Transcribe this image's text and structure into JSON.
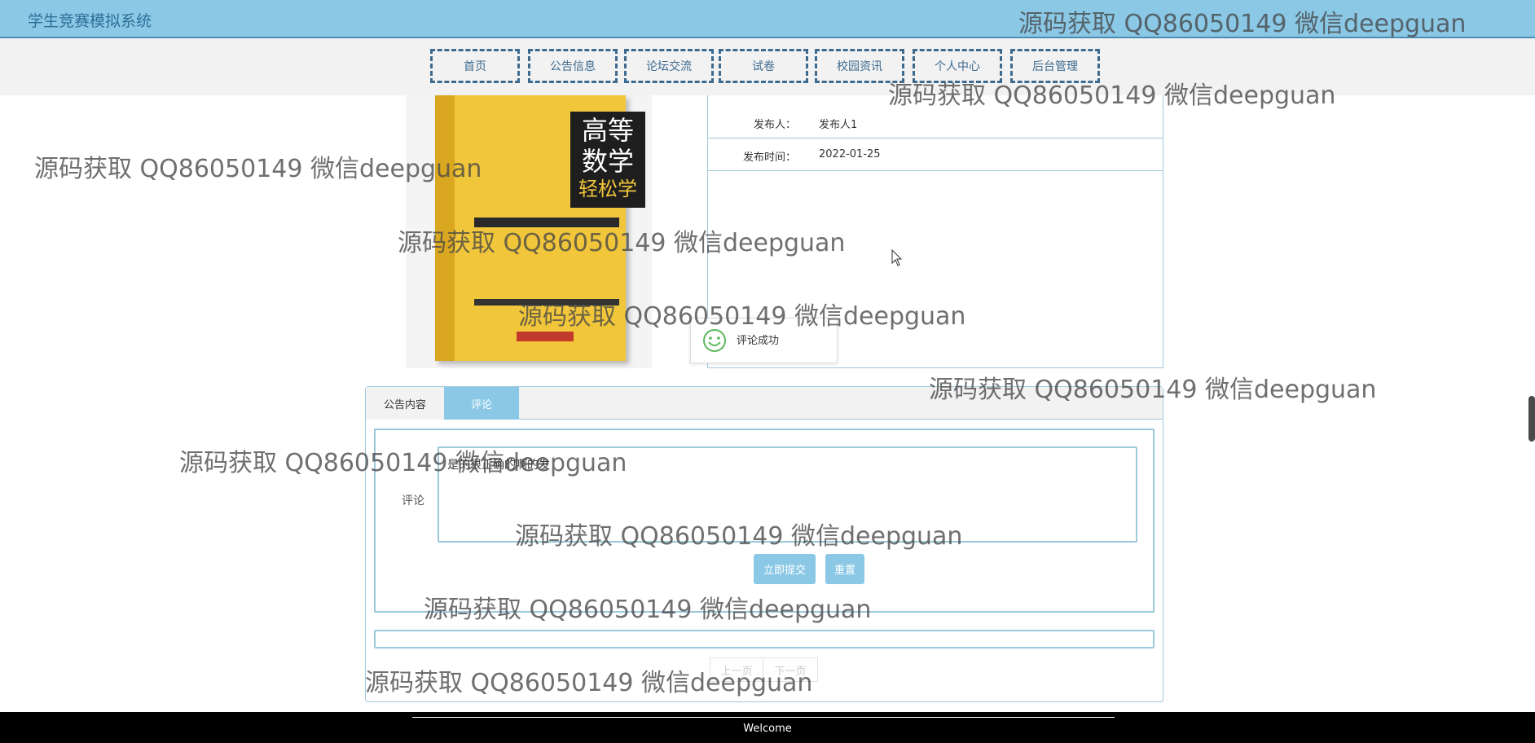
{
  "header": {
    "title": "学生竞赛模拟系统"
  },
  "nav": [
    {
      "label": "首页"
    },
    {
      "label": "公告信息"
    },
    {
      "label": "论坛交流"
    },
    {
      "label": "试卷"
    },
    {
      "label": "校园资讯"
    },
    {
      "label": "个人中心"
    },
    {
      "label": "后台管理"
    }
  ],
  "book": {
    "cover_title_1": "高等",
    "cover_title_2": "数学",
    "cover_subtitle": "轻松学"
  },
  "info": {
    "publisher_label": "发布人：",
    "publisher_value": "发布人1",
    "time_label": "发布时间：",
    "time_value": "2022-01-25"
  },
  "toast": {
    "message": "评论成功"
  },
  "tabs": [
    {
      "label": "公告内容"
    },
    {
      "label": "评论"
    }
  ],
  "comment_form": {
    "label": "评论",
    "value": "是的很正确的啊的发",
    "submit_label": "立即提交",
    "reset_label": "重置"
  },
  "pager": {
    "prev_label": "上一页",
    "next_label": "下一页"
  },
  "footer": {
    "text": "Welcome"
  },
  "watermark": "源码获取 QQ86050149 微信deepguan",
  "colors": {
    "accent": "#8ac8e6",
    "nav_border": "#3d6a8f",
    "panel_border": "#9cc9db"
  },
  "icons": {
    "toast": "smile-icon",
    "cursor": "mouse-pointer-icon"
  }
}
